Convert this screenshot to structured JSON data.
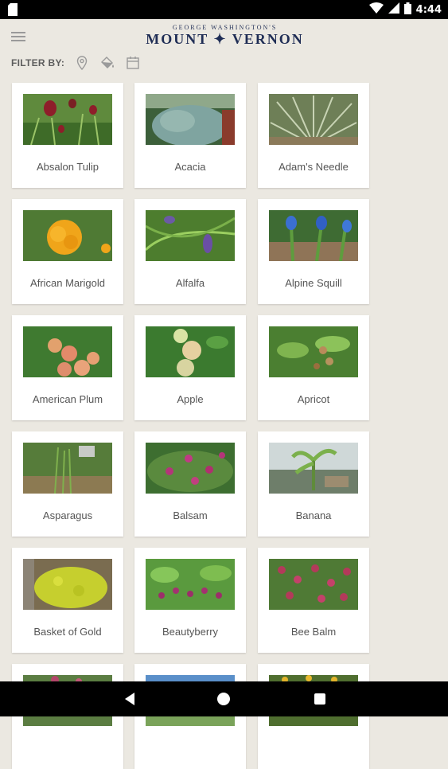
{
  "status_bar": {
    "time": "4:44"
  },
  "header": {
    "logo_small": "GEORGE WASHINGTON'S",
    "logo_big": "MOUNT ✦ VERNON"
  },
  "filter": {
    "label": "FILTER BY:",
    "icons": [
      "location-pin-icon",
      "paint-bucket-icon",
      "calendar-icon"
    ]
  },
  "plants": [
    {
      "name": "Absalon Tulip"
    },
    {
      "name": "Acacia"
    },
    {
      "name": "Adam's Needle"
    },
    {
      "name": "African Marigold"
    },
    {
      "name": "Alfalfa"
    },
    {
      "name": "Alpine Squill"
    },
    {
      "name": "American Plum"
    },
    {
      "name": "Apple"
    },
    {
      "name": "Apricot"
    },
    {
      "name": "Asparagus"
    },
    {
      "name": "Balsam"
    },
    {
      "name": "Banana"
    },
    {
      "name": "Basket of Gold"
    },
    {
      "name": "Beautyberry"
    },
    {
      "name": "Bee Balm"
    }
  ],
  "colors": {
    "brand": "#1f2d55",
    "background": "#ebe8e1"
  }
}
